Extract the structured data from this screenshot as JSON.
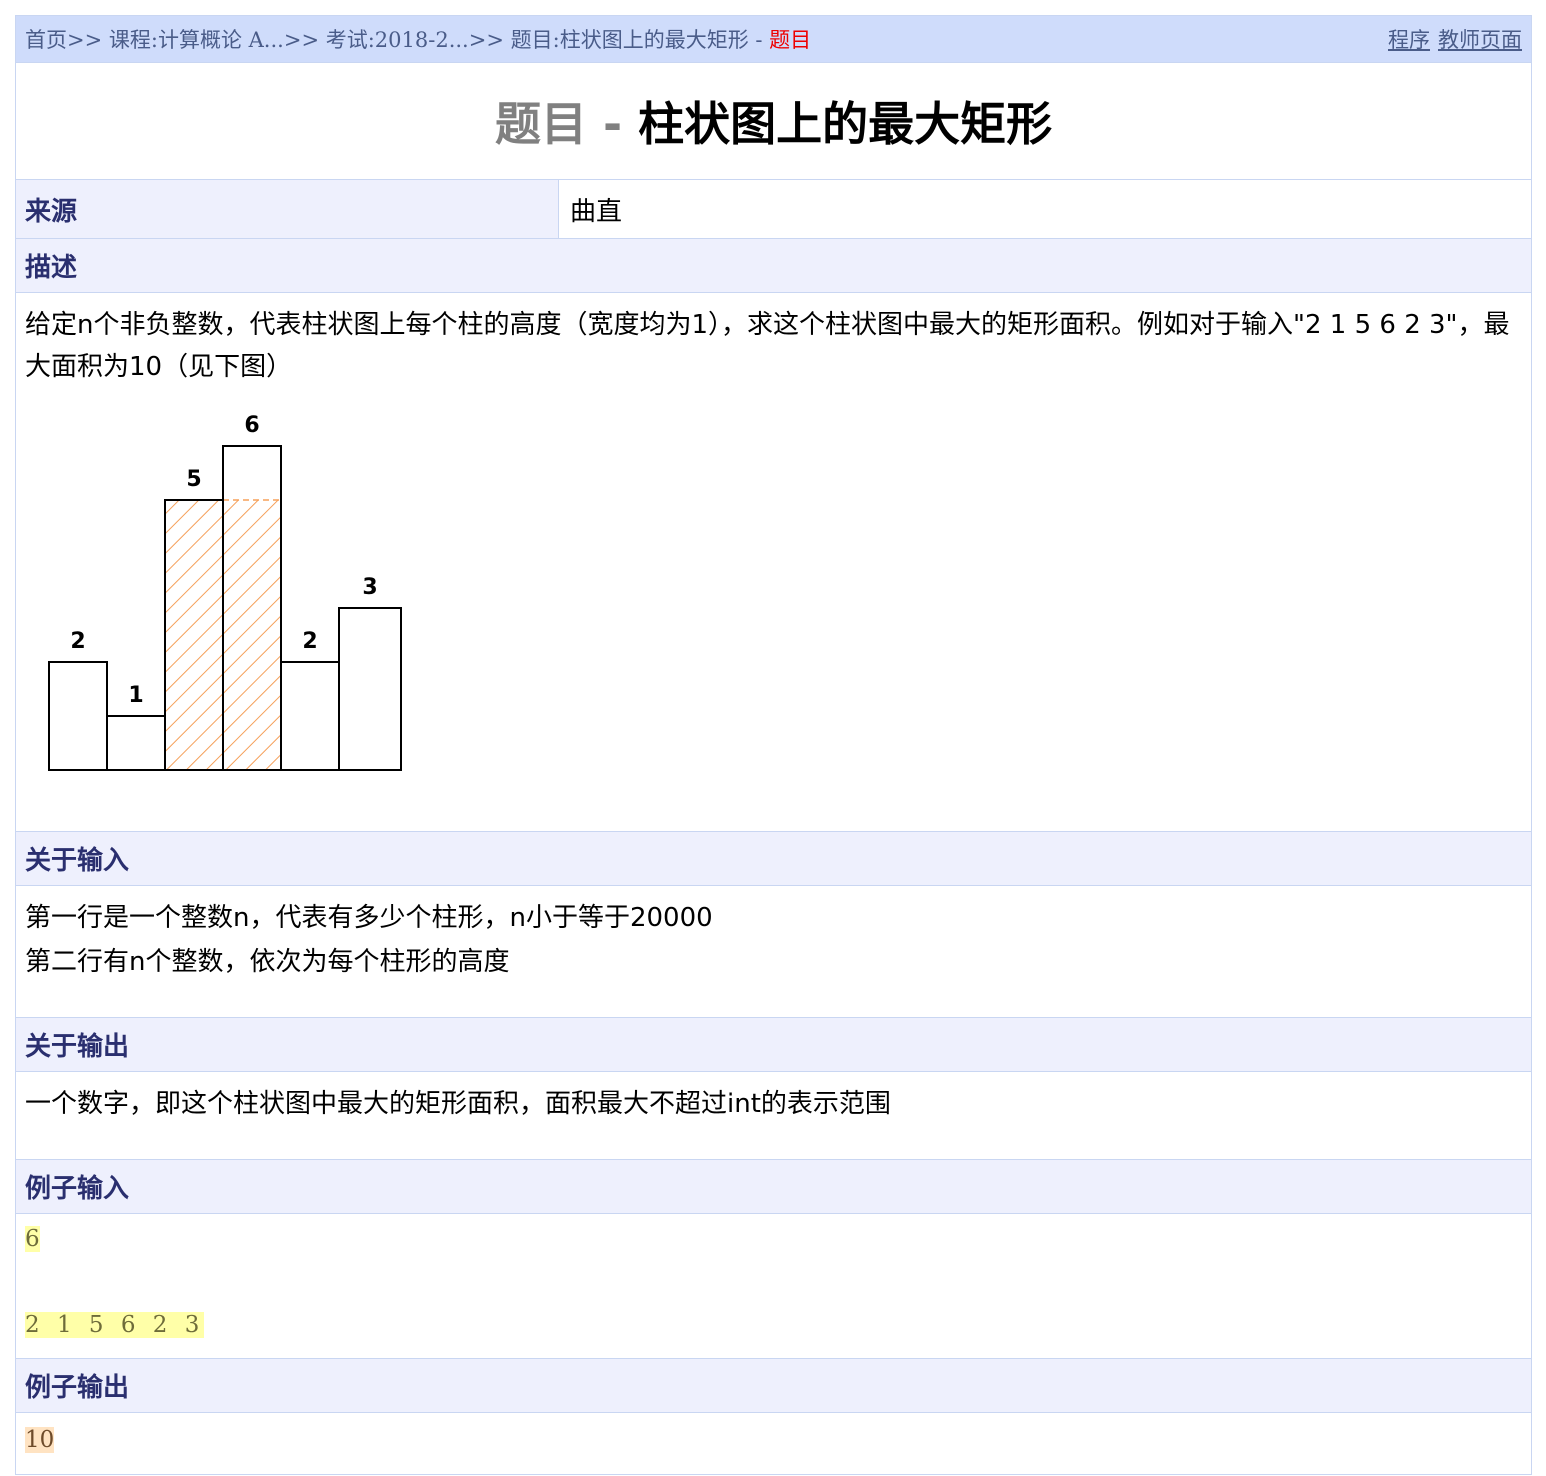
{
  "breadcrumb": {
    "items": [
      "首页",
      "课程:计算概论 A...",
      "考试:2018-2...",
      "题目:柱状图上的最大矩形"
    ],
    "separator": ">>",
    "dash": " - ",
    "current": "题目"
  },
  "top_links": {
    "program": "程序",
    "teacher_page": "教师页面"
  },
  "title": {
    "prefix": "题目",
    "separator": "-",
    "name": "柱状图上的最大矩形"
  },
  "source": {
    "label": "来源",
    "value": "曲直"
  },
  "description": {
    "header": "描述",
    "text": "给定n个非负整数，代表柱状图上每个柱的高度（宽度均为1），求这个柱状图中最大的矩形面积。例如对于输入\"2 1 5 6 2 3\"，最大面积为10（见下图）",
    "figure": {
      "heights": [
        2,
        1,
        5,
        6,
        2,
        3
      ],
      "labels": [
        "2",
        "1",
        "5",
        "6",
        "2",
        "3"
      ],
      "highlight_bars": [
        2,
        3
      ],
      "highlight_height": 5,
      "highlight_color": "#f5a05a"
    }
  },
  "input": {
    "header": "关于输入",
    "lines": [
      "第一行是一个整数n，代表有多少个柱形，n小于等于20000",
      "第二行有n个整数，依次为每个柱形的高度"
    ]
  },
  "output": {
    "header": "关于输出",
    "text": "一个数字，即这个柱状图中最大的矩形面积，面积最大不超过int的表示范围"
  },
  "sample_input": {
    "header": "例子输入",
    "lines": [
      "6",
      "2 1 5 6 2 3"
    ]
  },
  "sample_output": {
    "header": "例子输出",
    "text": "10"
  },
  "colors": {
    "topbar_bg": "#cfdcfb",
    "section_bg": "#eef0fd",
    "current_crumb": "#ee0000",
    "heading_text": "#2a2f6f"
  }
}
